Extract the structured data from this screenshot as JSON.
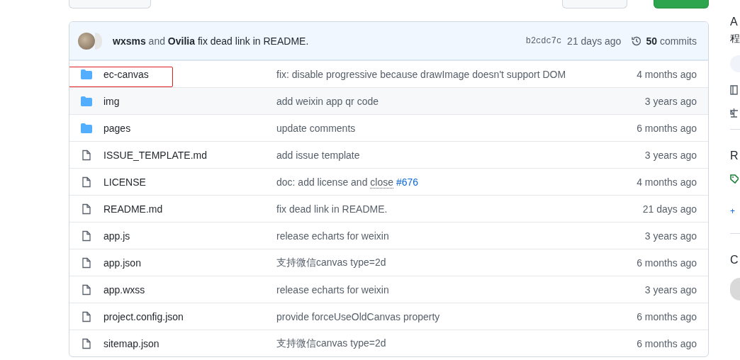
{
  "commit": {
    "authors": [
      "wxsms",
      "Ovilia"
    ],
    "joiner": "and",
    "message": "fix dead link in README.",
    "sha": "b2cdc7c",
    "age": "21 days ago",
    "count": "50",
    "count_label": "commits"
  },
  "files": [
    {
      "name": "ec-canvas",
      "kind": "dir",
      "message": "fix: disable progressive because drawImage doesn't support DOM",
      "age": "4 months ago",
      "hovered": false,
      "highlighted": true
    },
    {
      "name": "img",
      "kind": "dir",
      "message": "add weixin app qr code",
      "age": "3 years ago",
      "hovered": true,
      "highlighted": false
    },
    {
      "name": "pages",
      "kind": "dir",
      "message": "update comments",
      "age": "6 months ago",
      "hovered": false,
      "highlighted": false
    },
    {
      "name": "ISSUE_TEMPLATE.md",
      "kind": "file",
      "message": "add issue template",
      "age": "3 years ago",
      "hovered": false,
      "highlighted": false
    },
    {
      "name": "LICENSE",
      "kind": "file",
      "message": [
        {
          "text": "doc: add license and",
          "kind": "plain"
        },
        {
          "text": "close",
          "kind": "keyword"
        },
        {
          "text": "#676",
          "kind": "link"
        }
      ],
      "age": "4 months ago",
      "hovered": false,
      "highlighted": false
    },
    {
      "name": "README.md",
      "kind": "file",
      "message": "fix dead link in README.",
      "age": "21 days ago",
      "hovered": false,
      "highlighted": false
    },
    {
      "name": "app.js",
      "kind": "file",
      "message": "release echarts for weixin",
      "age": "3 years ago",
      "hovered": false,
      "highlighted": false
    },
    {
      "name": "app.json",
      "kind": "file",
      "message": "支持微信canvas type=2d",
      "age": "6 months ago",
      "hovered": false,
      "highlighted": false
    },
    {
      "name": "app.wxss",
      "kind": "file",
      "message": "release echarts for weixin",
      "age": "3 years ago",
      "hovered": false,
      "highlighted": false
    },
    {
      "name": "project.config.json",
      "kind": "file",
      "message": "provide forceUseOldCanvas property",
      "age": "6 months ago",
      "hovered": false,
      "highlighted": false
    },
    {
      "name": "sitemap.json",
      "kind": "file",
      "message": "支持微信canvas type=2d",
      "age": "6 months ago",
      "hovered": false,
      "highlighted": false
    }
  ],
  "sidebar": {
    "about_heading": "A",
    "description": "程",
    "releases_heading": "R",
    "plus": "+",
    "contributors_heading": "C"
  }
}
